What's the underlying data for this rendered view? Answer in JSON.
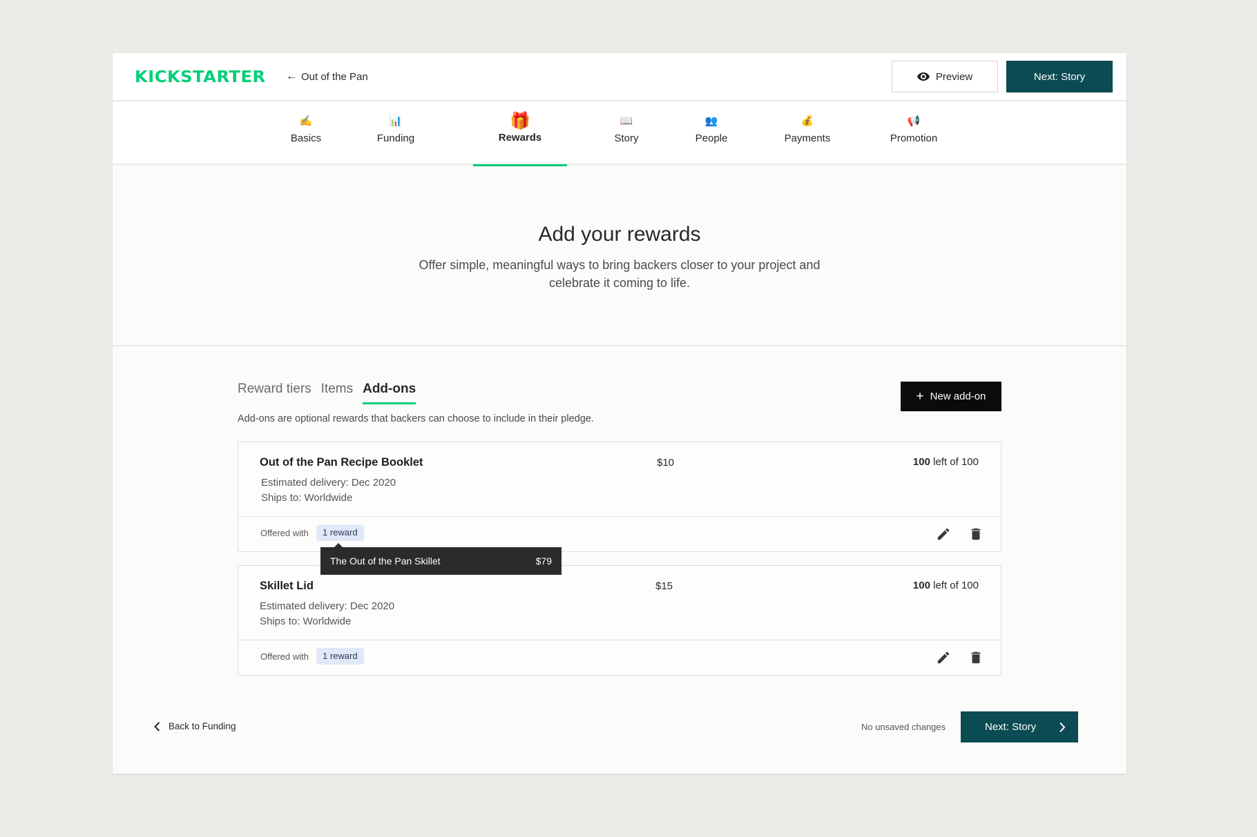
{
  "header": {
    "logo": "KICKSTARTER",
    "project": "Out of the Pan",
    "preview": "Preview",
    "next": "Next: Story"
  },
  "nav": [
    {
      "label": "Basics",
      "emoji": "✍️"
    },
    {
      "label": "Funding",
      "emoji": "📊"
    },
    {
      "label": "Rewards",
      "emoji": "🎁"
    },
    {
      "label": "Story",
      "emoji": "📖"
    },
    {
      "label": "People",
      "emoji": "👥"
    },
    {
      "label": "Payments",
      "emoji": "💰"
    },
    {
      "label": "Promotion",
      "emoji": "📢"
    }
  ],
  "hero": {
    "title": "Add your rewards",
    "subtitle": "Offer simple, meaningful ways to bring backers closer to your project and celebrate it coming to life."
  },
  "tabs": [
    "Reward tiers",
    "Items",
    "Add-ons"
  ],
  "description": "Add-ons are optional rewards that backers can choose to include in their pledge.",
  "new_addon": "New add-on",
  "addons": [
    {
      "name": "Out of the Pan Recipe Booklet",
      "price": "$10",
      "left_count": "100",
      "left_text": " left of 100",
      "delivery": "Estimated delivery: Dec 2020",
      "ships": "Ships to: Worldwide",
      "offered": "Offered with",
      "chip": "1 reward"
    },
    {
      "name": "Skillet Lid",
      "price": "$15",
      "left_count": "100",
      "left_text": " left of 100",
      "delivery": "Estimated delivery: Dec 2020",
      "ships": "Ships to: Worldwide",
      "offered": "Offered with",
      "chip": "1 reward"
    }
  ],
  "tooltip": {
    "name": "The Out of the Pan Skillet",
    "price": "$79"
  },
  "footer": {
    "back": "Back to Funding",
    "unsaved": "No unsaved changes",
    "next": "Next: Story"
  },
  "colors": {
    "accent": "#05ce78",
    "primary": "#0b4b53",
    "background": "#ebeae6"
  }
}
